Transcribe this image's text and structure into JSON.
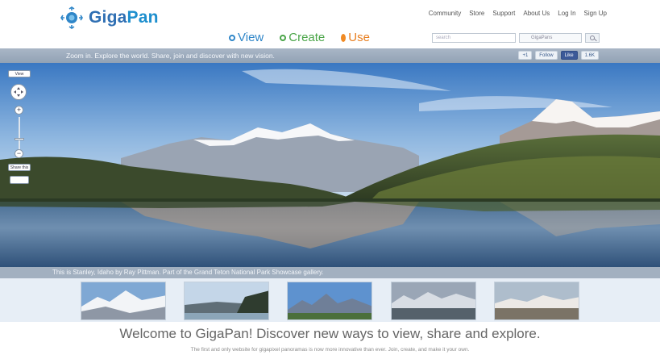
{
  "app": {
    "name_part1": "Giga",
    "name_part2": "Pan"
  },
  "topnav": [
    "Community",
    "Store",
    "Support",
    "About Us",
    "Log In",
    "Sign Up"
  ],
  "mainnav": {
    "view": "View",
    "create": "Create",
    "use": "Use"
  },
  "search": {
    "placeholder": "search",
    "select_value": "GigaPans"
  },
  "tagline": "Zoom in. Explore the world. Share, join and discover with new vision.",
  "social": {
    "share": "+1",
    "follow": "Follow",
    "like": "Like",
    "like_count": "1.6K"
  },
  "viewer": {
    "view_label": "View",
    "more_label": "Share this"
  },
  "caption": "This is Stanley, Idaho by Ray Pittman. Part of the Grand Teton National Park Showcase gallery.",
  "welcome": "Welcome to GigaPan! Discover new ways to view, share and explore.",
  "subwelcome": "The first and only website for gigapixel panoramas is now more innovative than ever. Join, create, and make it your own.",
  "colors": {
    "brand_blue": "#2f86c8",
    "create_green": "#4aa548",
    "use_orange": "#e87f20",
    "band_gray": "#a2b0c0"
  }
}
